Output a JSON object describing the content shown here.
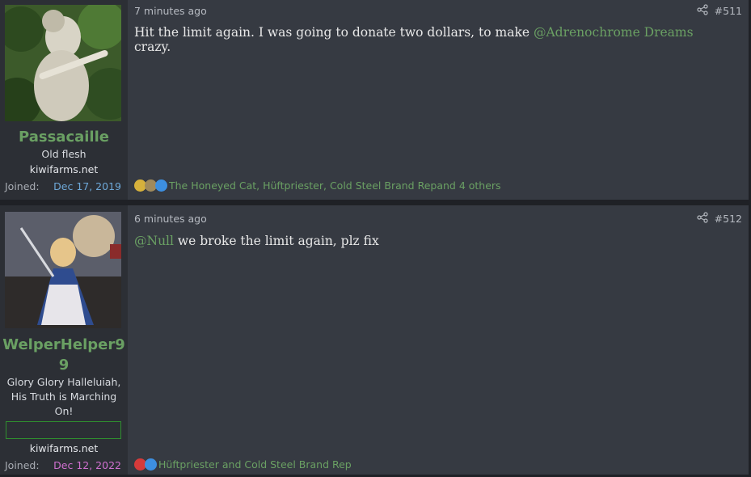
{
  "posts": [
    {
      "username": "Passacaille",
      "user_title": "Old flesh",
      "banner": "",
      "site": "kiwifarms.net",
      "joined_label": "Joined:",
      "joined_date": "Dec 17, 2019",
      "joined_color": "#6ea8d8",
      "time": "7 minutes ago",
      "number": "#511",
      "message_before": "Hit the limit again. I was going to donate two dollars, to make ",
      "mention": "@Adrenochrome Dreams",
      "message_after": " crazy.",
      "reaction_users": "The Honeyed Cat, Hüftpriester, Cold Steel Brand Rep",
      "reaction_others": " and 4 others",
      "reaction_icons": [
        "medal-icon",
        "coin-icon",
        "like-icon"
      ]
    },
    {
      "username": "WelperHelper9",
      "username_line2": "9",
      "user_title_lines": [
        "Glory Glory Halleluiah,",
        "His Truth is Marching",
        "On!"
      ],
      "banner": "",
      "site": "kiwifarms.net",
      "joined_label": "Joined:",
      "joined_date": "Dec 12, 2022",
      "joined_color": "#d070d0",
      "time": "6 minutes ago",
      "number": "#512",
      "mention": "@Null",
      "message_after": " we broke the limit again, plz fix",
      "reaction_text": "Hüftpriester and Cold Steel Brand Rep",
      "reaction_icons": [
        "heart-icon",
        "like-icon"
      ]
    }
  ]
}
